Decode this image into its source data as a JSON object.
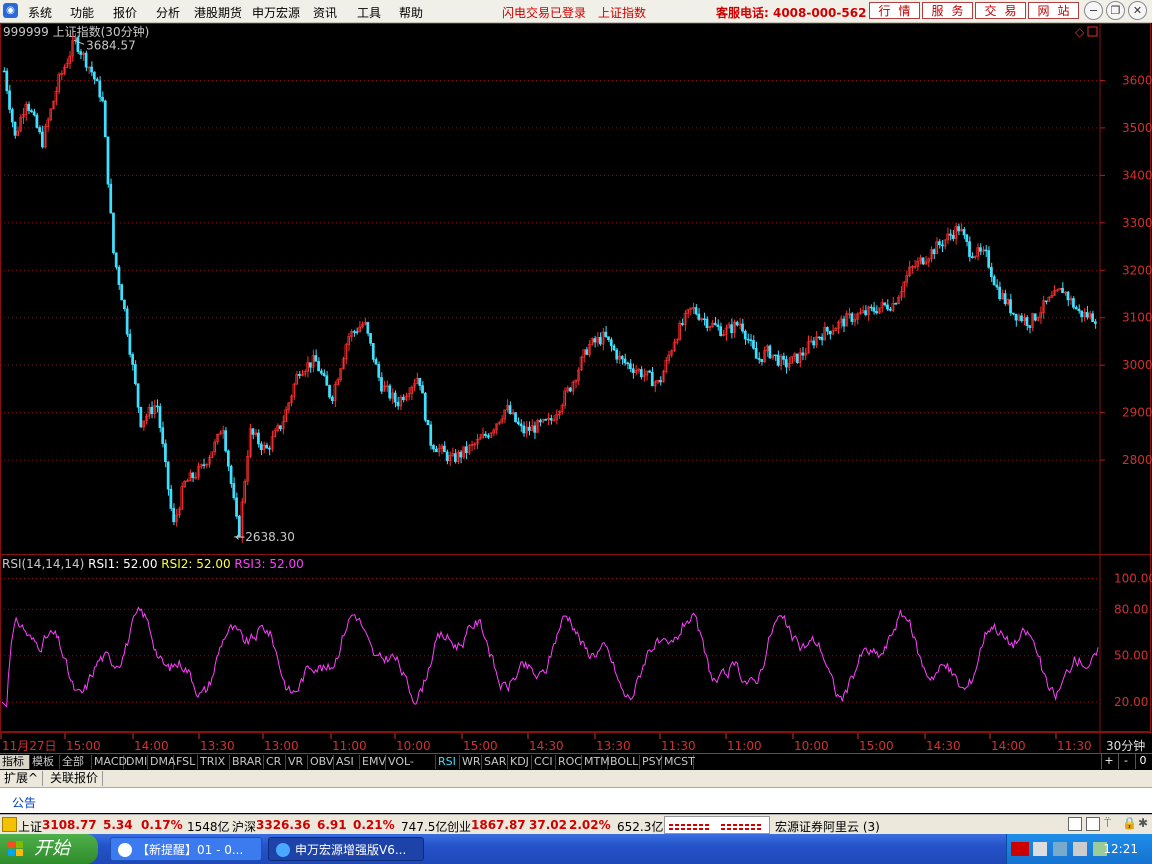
{
  "menu": {
    "items": [
      "系统",
      "功能",
      "报价",
      "分析",
      "港股期货",
      "申万宏源",
      "资讯",
      "工具",
      "帮助"
    ],
    "flash_status": "闪电交易已登录",
    "current_index": "上证指数",
    "hotline": "客服电话: 4008-000-562",
    "quick_buttons": [
      "行情",
      "服务",
      "交易",
      "网站"
    ]
  },
  "chart_header": {
    "code_name": "999999 上证指数(30分钟)",
    "high_label": "3684.57",
    "low_label": "2638.30"
  },
  "rsi_header": {
    "name": "RSI(14,14,14)",
    "rsi1": "RSI1: 52.00",
    "rsi2": "RSI2: 52.00",
    "rsi3": "RSI3: 52.00"
  },
  "chart_data": {
    "type": "candlestick",
    "title": "999999 上证指数(30分钟)",
    "price_ticks": [
      3600,
      3500,
      3400,
      3300,
      3200,
      3100,
      3000,
      2900,
      2800
    ],
    "price_range": [
      2600,
      3700
    ],
    "high": 3684.57,
    "low": 2638.3,
    "x_ticks": [
      "11月27日",
      "15:00",
      "14:00",
      "13:30",
      "13:00",
      "11:00",
      "10:00",
      "15:00",
      "14:30",
      "13:30",
      "11:30",
      "11:00",
      "10:00",
      "15:00",
      "14:30",
      "14:00",
      "11:30"
    ],
    "period": "30分钟",
    "price_path": [
      [
        0,
        3620
      ],
      [
        0.01,
        3480
      ],
      [
        0.02,
        3560
      ],
      [
        0.035,
        3470
      ],
      [
        0.05,
        3600
      ],
      [
        0.065,
        3684.57
      ],
      [
        0.08,
        3620
      ],
      [
        0.09,
        3560
      ],
      [
        0.1,
        3240
      ],
      [
        0.11,
        3120
      ],
      [
        0.125,
        2880
      ],
      [
        0.14,
        2920
      ],
      [
        0.155,
        2660
      ],
      [
        0.165,
        2750
      ],
      [
        0.18,
        2780
      ],
      [
        0.195,
        2840
      ],
      [
        0.2,
        2880
      ],
      [
        0.215,
        2638.3
      ],
      [
        0.225,
        2860
      ],
      [
        0.24,
        2820
      ],
      [
        0.255,
        2880
      ],
      [
        0.27,
        2990
      ],
      [
        0.285,
        3010
      ],
      [
        0.3,
        2930
      ],
      [
        0.315,
        3060
      ],
      [
        0.33,
        3090
      ],
      [
        0.345,
        2960
      ],
      [
        0.36,
        2920
      ],
      [
        0.38,
        2980
      ],
      [
        0.39,
        2840
      ],
      [
        0.41,
        2800
      ],
      [
        0.43,
        2830
      ],
      [
        0.445,
        2860
      ],
      [
        0.46,
        2910
      ],
      [
        0.475,
        2860
      ],
      [
        0.5,
        2880
      ],
      [
        0.52,
        2960
      ],
      [
        0.535,
        3040
      ],
      [
        0.55,
        3060
      ],
      [
        0.565,
        3010
      ],
      [
        0.58,
        2990
      ],
      [
        0.6,
        2960
      ],
      [
        0.615,
        3060
      ],
      [
        0.63,
        3120
      ],
      [
        0.645,
        3090
      ],
      [
        0.66,
        3070
      ],
      [
        0.675,
        3090
      ],
      [
        0.69,
        3010
      ],
      [
        0.7,
        3030
      ],
      [
        0.715,
        3000
      ],
      [
        0.73,
        3020
      ],
      [
        0.745,
        3060
      ],
      [
        0.76,
        3080
      ],
      [
        0.775,
        3100
      ],
      [
        0.79,
        3110
      ],
      [
        0.8,
        3120
      ],
      [
        0.815,
        3130
      ],
      [
        0.83,
        3200
      ],
      [
        0.845,
        3230
      ],
      [
        0.86,
        3260
      ],
      [
        0.875,
        3290
      ],
      [
        0.885,
        3240
      ],
      [
        0.9,
        3230
      ],
      [
        0.91,
        3160
      ],
      [
        0.925,
        3110
      ],
      [
        0.94,
        3090
      ],
      [
        0.955,
        3130
      ],
      [
        0.97,
        3160
      ],
      [
        0.985,
        3110
      ],
      [
        1.0,
        3100
      ]
    ],
    "rsi_ticks": [
      100.0,
      80.0,
      50.0,
      20.0
    ],
    "rsi_range": [
      0,
      110
    ],
    "rsi_value": 52.0
  },
  "indicator_tabs": [
    "指标",
    "模板",
    "全部",
    "MACD",
    "DMI",
    "DMA",
    "FSL",
    "TRIX",
    "BRAR",
    "CR",
    "VR",
    "OBV",
    "ASI",
    "EMV",
    "VOL-TDX",
    "RSI",
    "WR",
    "SAR",
    "KDJ",
    "CCI",
    "ROC",
    "MTM",
    "BOLL",
    "PSY",
    "MCST"
  ],
  "active_indicator": "RSI",
  "zoom_buttons": [
    "+",
    "-",
    "0"
  ],
  "ext_tabs": [
    "扩展^",
    "关联报价"
  ],
  "notice_label": "公告",
  "status": {
    "sh_name": "上证",
    "sh_value": "3108.77",
    "sh_change": "5.34",
    "sh_pct": "0.17%",
    "sh_amount": "1548亿",
    "hs_name": "沪深",
    "hs_value": "3326.36",
    "hs_change": "6.91",
    "hs_pct": "0.21%",
    "hs_amount": "747.5亿",
    "cy_name": "创业",
    "cy_value": "1867.87",
    "cy_change": "37.02",
    "cy_pct": "2.02%",
    "cy_amount": "652.3亿",
    "server": "宏源证券阿里云 (3)"
  },
  "taskbar": {
    "start": "开始",
    "tasks": [
      "【新提醒】01 - 0...",
      "申万宏源增强版V6..."
    ],
    "clock": "12:21"
  }
}
